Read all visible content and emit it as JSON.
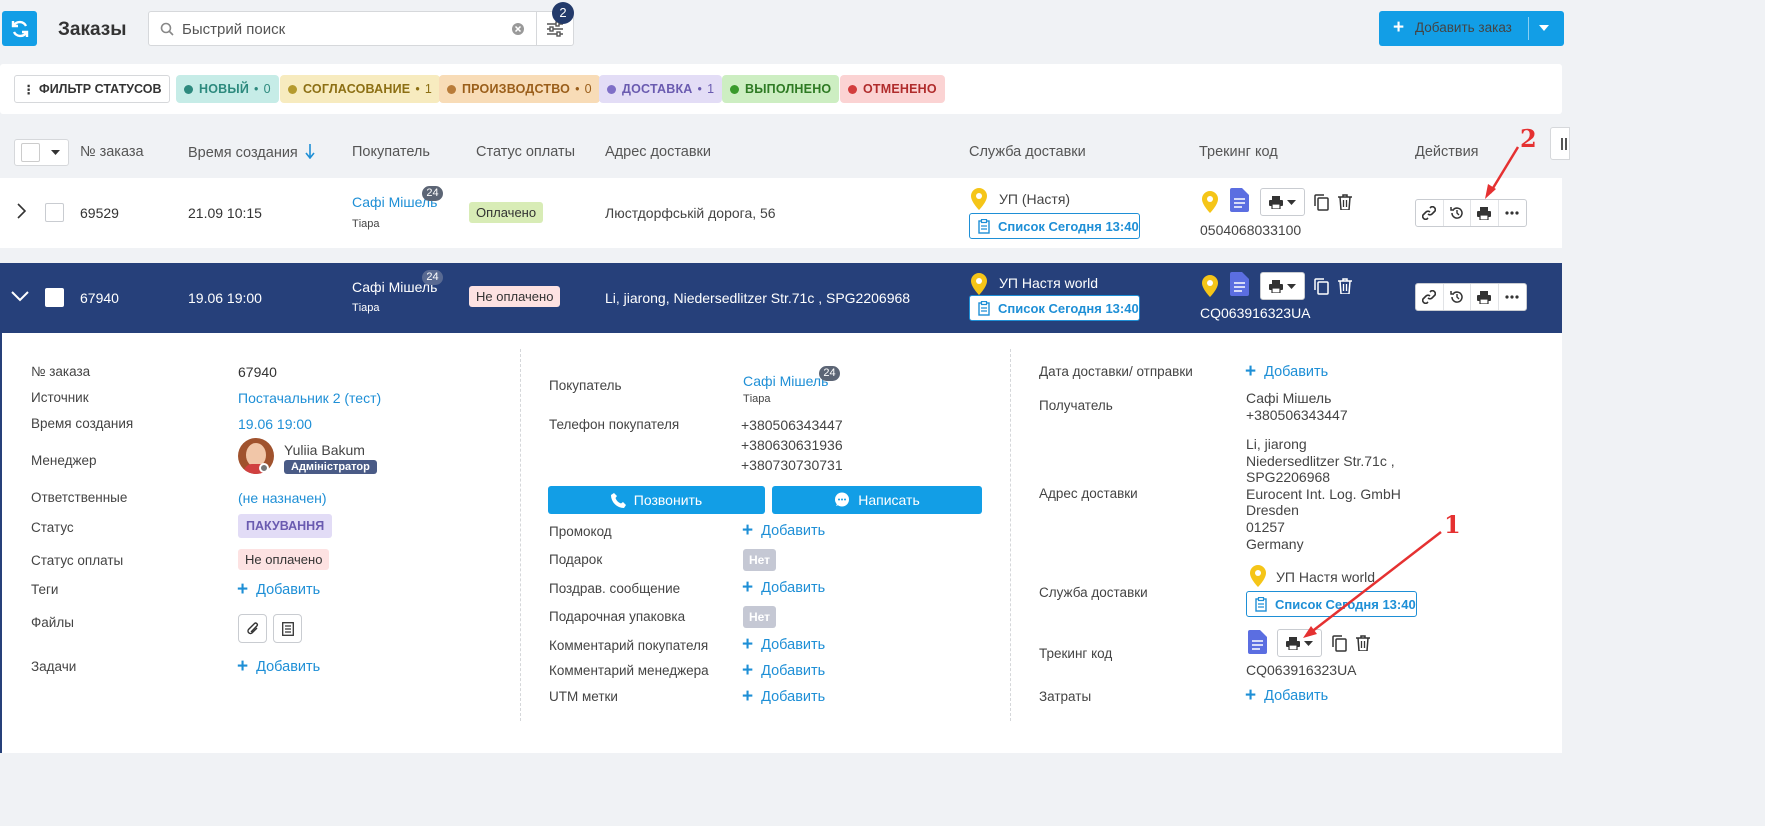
{
  "header": {
    "title": "Заказы",
    "search_placeholder": "Быстрий поиск",
    "filter_count": "2",
    "add_order": "Добавить заказ"
  },
  "status_filter": {
    "label": "ФИЛЬТР СТАТУСОВ",
    "chips": [
      {
        "label": "НОВЫЙ",
        "count": "0",
        "bg": "#c6ece7",
        "fg": "#2d8a7e",
        "dot": "#2d8a7e"
      },
      {
        "label": "СОГЛАСОВАНИЕ",
        "count": "1",
        "bg": "#f7ebbf",
        "fg": "#8c6f14",
        "dot": "#b59a2e"
      },
      {
        "label": "ПРОИЗВОДСТВО",
        "count": "0",
        "bg": "#f8dcb7",
        "fg": "#9a5e1a",
        "dot": "#b97c3a"
      },
      {
        "label": "ДОСТАВКА",
        "count": "1",
        "bg": "#e3ddf6",
        "fg": "#6a5bb0",
        "dot": "#7f6fc7"
      },
      {
        "label": "ВЫПОЛНЕНО",
        "count": "",
        "bg": "#cdeec2",
        "fg": "#2e7a23",
        "dot": "#3a9a2c"
      },
      {
        "label": "ОТМЕНЕНО",
        "count": "",
        "bg": "#fbd3d3",
        "fg": "#b02c2c",
        "dot": "#d33d3d"
      }
    ]
  },
  "columns": {
    "order_no": "№ заказа",
    "created": "Время создания",
    "buyer": "Покупатель",
    "pay_status": "Статус оплаты",
    "address": "Адрес доставки",
    "delivery": "Служба доставки",
    "tracking": "Трекинг код",
    "actions": "Действия"
  },
  "rows": [
    {
      "order_no": "69529",
      "created": "21.09 10:15",
      "buyer": "Сафі Мішель",
      "buyer_sub": "Тіара",
      "badge": "24",
      "pay_status": "Оплачено",
      "address": "Люстдорфській дорога, 56",
      "delivery": "УП (Настя)",
      "list_btn": "Список Сегодня 13:40",
      "tracking": "0504068033100"
    },
    {
      "order_no": "67940",
      "created": "19.06 19:00",
      "buyer": "Сафі Мішель",
      "buyer_sub": "Тіара",
      "badge": "24",
      "pay_status": "Не оплачено",
      "address": "Li, jiarong, Niedersedlitzer Str.71c , SPG2206968",
      "delivery": "УП Настя world",
      "list_btn": "Список Сегодня 13:40",
      "tracking": "CQ063916323UA"
    }
  ],
  "detail": {
    "col1": {
      "order_no_label": "№ заказа",
      "order_no": "67940",
      "source_label": "Источник",
      "source": "Постачальник 2 (тест)",
      "created_label": "Время создания",
      "created": "19.06 19:00",
      "manager_label": "Менеджер",
      "manager_name": "Yuliia Bakum",
      "manager_role": "Адміністратор",
      "responsible_label": "Ответственные",
      "responsible": "(не назначен)",
      "status_label": "Статус",
      "status": "ПАКУВАННЯ",
      "pay_label": "Статус оплаты",
      "pay": "Не оплачено",
      "tags_label": "Теги",
      "tags_add": "Добавить",
      "files_label": "Файлы",
      "tasks_label": "Задачи",
      "tasks_add": "Добавить"
    },
    "col2": {
      "buyer_label": "Покупатель",
      "buyer": "Сафі Мішель",
      "buyer_sub": "Тіара",
      "badge": "24",
      "phone_label": "Телефон покупателя",
      "phones": [
        "+380506343447",
        "+380630631936",
        "+380730730731"
      ],
      "call": "Позвонить",
      "write": "Написать",
      "promo_label": "Промокод",
      "promo_add": "Добавить",
      "gift_label": "Подарок",
      "gift": "Нет",
      "greeting_label": "Поздрав. сообщение",
      "greeting_add": "Добавить",
      "wrap_label": "Подарочная упаковка",
      "wrap": "Нет",
      "buyer_comment_label": "Комментарий покупателя",
      "buyer_comment_add": "Добавить",
      "manager_comment_label": "Комментарий менеджера",
      "manager_comment_add": "Добавить",
      "utm_label": "UTM метки",
      "utm_add": "Добавить"
    },
    "col3": {
      "date_label": "Дата доставки/ отправки",
      "date_add": "Добавить",
      "recipient_label": "Получатель",
      "recipient_name": "Сафі Мішель",
      "recipient_phone": "+380506343447",
      "address_label": "Адрес доставки",
      "address_lines": [
        "Li, jiarong",
        "Niedersedlitzer Str.71c ,",
        "SPG2206968",
        "Eurocent Int. Log. GmbH",
        "Dresden",
        "01257",
        "Germany"
      ],
      "delivery_label": "Служба доставки",
      "delivery": "УП Настя world",
      "list_btn": "Список Сегодня 13:40",
      "tracking_label": "Трекинг код",
      "tracking": "CQ063916323UA",
      "costs_label": "Затраты",
      "costs_add": "Добавить"
    }
  },
  "annotations": {
    "one": "1",
    "two": "2"
  }
}
